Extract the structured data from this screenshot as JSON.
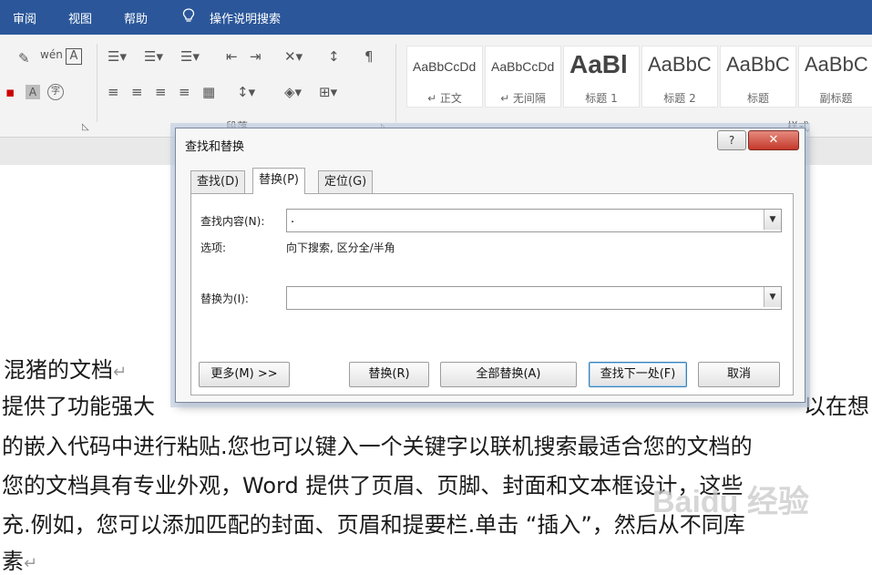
{
  "ribbon_tabs": [
    "审阅",
    "视图",
    "帮助"
  ],
  "tell_me": "操作说明搜索",
  "ribbon": {
    "paragraph_group": "段落",
    "styles_group": "样式",
    "styles": [
      {
        "sample": "AaBbCcDd",
        "name": "↵ 正文"
      },
      {
        "sample": "AaBbCcDd",
        "name": "↵ 无间隔"
      },
      {
        "sample": "AaBl",
        "name": "标题 1"
      },
      {
        "sample": "AaBbC",
        "name": "标题 2"
      },
      {
        "sample": "AaBbC",
        "name": "标题"
      },
      {
        "sample": "AaBbC",
        "name": "副标题"
      }
    ]
  },
  "document": {
    "lines": [
      "混猪的文档",
      "提供了功能强大",
      "以在想",
      "的嵌入代码中进行粘贴.您也可以键入一个关键字以联机搜索最适合您的文档的",
      "您的文档具有专业外观，Word 提供了页眉、页脚、封面和文本框设计，这些",
      "充.例如，您可以添加匹配的封面、页眉和提要栏.单击 “插入”，然后从不同库",
      "素"
    ],
    "pilcrow": "↵",
    "watermark": "Baidu 经验"
  },
  "dialog": {
    "title": "查找和替换",
    "help_label": "?",
    "close_label": "✕",
    "tabs": [
      "查找(D)",
      "替换(P)",
      "定位(G)"
    ],
    "active_tab": "替换(P)",
    "find_label": "查找内容(N):",
    "find_value": ".",
    "options_label": "选项:",
    "options_value": "向下搜索, 区分全/半角",
    "replace_label": "替换为(I):",
    "replace_value": "",
    "buttons": {
      "more": "更多(M) >>",
      "replace": "替换(R)",
      "replace_all": "全部替换(A)",
      "find_next": "查找下一处(F)",
      "cancel": "取消"
    }
  }
}
